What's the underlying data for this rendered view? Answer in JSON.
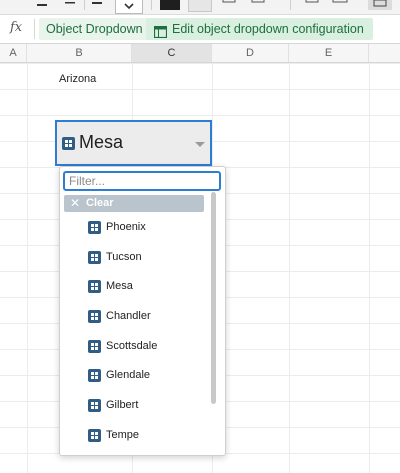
{
  "formula_bar": {
    "fx_label": "fx",
    "cell_type_label": "Object Dropdown",
    "edit_config_label": "Edit object dropdown configuration"
  },
  "columns": [
    "A",
    "B",
    "C",
    "D",
    "E"
  ],
  "cells": {
    "b3": "Arizona"
  },
  "dropdown": {
    "selected_value": "Mesa",
    "filter_placeholder": "Filter...",
    "clear_label": "Clear",
    "options": [
      "Phoenix",
      "Tucson",
      "Mesa",
      "Chandler",
      "Scottsdale",
      "Glendale",
      "Gilbert",
      "Tempe"
    ]
  },
  "colors": {
    "accent": "#2f7dd1",
    "object_icon": "#2f5d86",
    "formula_chip_bg": "#d9f0e1",
    "formula_chip_text": "#1f6e3e"
  },
  "icons": {
    "object": "building-icon",
    "clear": "close-icon",
    "caret": "chevron-down-icon"
  }
}
